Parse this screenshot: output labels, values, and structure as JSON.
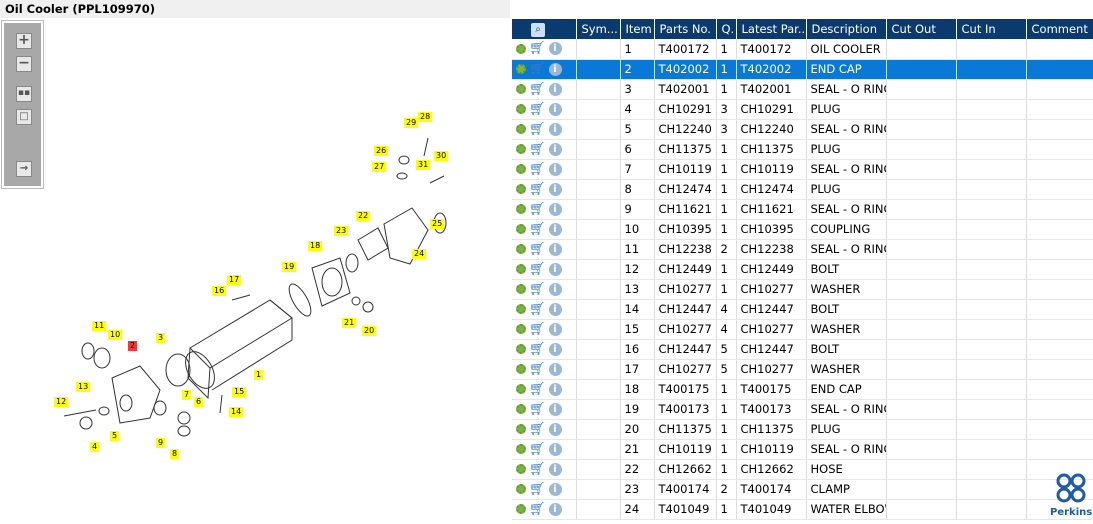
{
  "title": "Oil Cooler (PPL109970)",
  "toolbar": {
    "icons": [
      "zoom-in-icon",
      "zoom-out-icon",
      "fit-all-icon",
      "fit-window-icon",
      "expand-panel-icon"
    ]
  },
  "diagram": {
    "callouts": [
      {
        "label": "29",
        "highlight": false
      },
      {
        "label": "28",
        "highlight": false
      },
      {
        "label": "26",
        "highlight": false
      },
      {
        "label": "27",
        "highlight": false
      },
      {
        "label": "31",
        "highlight": false
      },
      {
        "label": "30",
        "highlight": false
      },
      {
        "label": "25",
        "highlight": false
      },
      {
        "label": "22",
        "highlight": false
      },
      {
        "label": "23",
        "highlight": false
      },
      {
        "label": "24",
        "highlight": false
      },
      {
        "label": "18",
        "highlight": false
      },
      {
        "label": "19",
        "highlight": false
      },
      {
        "label": "17",
        "highlight": false
      },
      {
        "label": "16",
        "highlight": false
      },
      {
        "label": "21",
        "highlight": false
      },
      {
        "label": "20",
        "highlight": false
      },
      {
        "label": "11",
        "highlight": false
      },
      {
        "label": "10",
        "highlight": false
      },
      {
        "label": "3",
        "highlight": false
      },
      {
        "label": "2",
        "highlight": true
      },
      {
        "label": "1",
        "highlight": false
      },
      {
        "label": "13",
        "highlight": false
      },
      {
        "label": "12",
        "highlight": false
      },
      {
        "label": "7",
        "highlight": false
      },
      {
        "label": "15",
        "highlight": false
      },
      {
        "label": "6",
        "highlight": false
      },
      {
        "label": "5",
        "highlight": false
      },
      {
        "label": "14",
        "highlight": false
      },
      {
        "label": "4",
        "highlight": false
      },
      {
        "label": "9",
        "highlight": false
      },
      {
        "label": "8",
        "highlight": false
      }
    ]
  },
  "table": {
    "columns": [
      "",
      "Sym...",
      "Item",
      "Parts No.",
      "Q.",
      "Latest Par...",
      "Description",
      "Cut Out",
      "Cut In",
      "Comment"
    ],
    "selected_item": "2",
    "rows": [
      [
        "1",
        "T400172",
        "1",
        "T400172",
        "OIL COOLER"
      ],
      [
        "2",
        "T402002",
        "1",
        "T402002",
        "END CAP"
      ],
      [
        "3",
        "T402001",
        "1",
        "T402001",
        "SEAL - O RING"
      ],
      [
        "4",
        "CH10291",
        "3",
        "CH10291",
        "PLUG"
      ],
      [
        "5",
        "CH12240",
        "3",
        "CH12240",
        "SEAL - O RING"
      ],
      [
        "6",
        "CH11375",
        "1",
        "CH11375",
        "PLUG"
      ],
      [
        "7",
        "CH10119",
        "1",
        "CH10119",
        "SEAL - O RING"
      ],
      [
        "8",
        "CH12474",
        "1",
        "CH12474",
        "PLUG"
      ],
      [
        "9",
        "CH11621",
        "1",
        "CH11621",
        "SEAL - O RING"
      ],
      [
        "10",
        "CH10395",
        "1",
        "CH10395",
        "COUPLING"
      ],
      [
        "11",
        "CH12238",
        "2",
        "CH12238",
        "SEAL - O RING"
      ],
      [
        "12",
        "CH12449",
        "1",
        "CH12449",
        "BOLT"
      ],
      [
        "13",
        "CH10277",
        "1",
        "CH10277",
        "WASHER"
      ],
      [
        "14",
        "CH12447",
        "4",
        "CH12447",
        "BOLT"
      ],
      [
        "15",
        "CH10277",
        "4",
        "CH10277",
        "WASHER"
      ],
      [
        "16",
        "CH12447",
        "5",
        "CH12447",
        "BOLT"
      ],
      [
        "17",
        "CH10277",
        "5",
        "CH10277",
        "WASHER"
      ],
      [
        "18",
        "T400175",
        "1",
        "T400175",
        "END CAP"
      ],
      [
        "19",
        "T400173",
        "1",
        "T400173",
        "SEAL - O RING"
      ],
      [
        "20",
        "CH11375",
        "1",
        "CH11375",
        "PLUG"
      ],
      [
        "21",
        "CH10119",
        "1",
        "CH10119",
        "SEAL - O RING"
      ],
      [
        "22",
        "CH12662",
        "1",
        "CH12662",
        "HOSE"
      ],
      [
        "23",
        "T400174",
        "2",
        "T400174",
        "CLAMP"
      ],
      [
        "24",
        "T401049",
        "1",
        "T401049",
        "WATER ELBOW"
      ]
    ]
  },
  "logo": {
    "text": "Perkins"
  }
}
